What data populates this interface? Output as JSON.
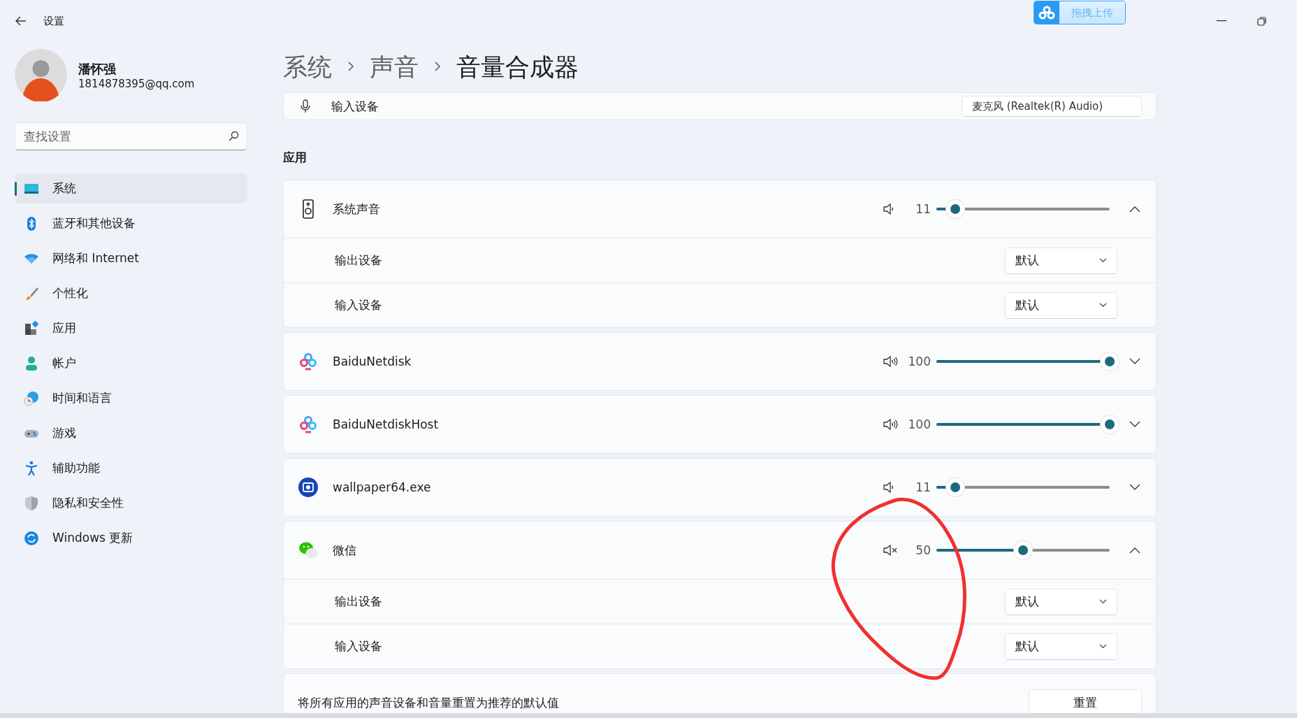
{
  "window": {
    "title": "设置"
  },
  "upload_widget": {
    "label": "拖拽上传"
  },
  "user": {
    "name": "潘怀强",
    "email": "1814878395@qq.com"
  },
  "search": {
    "placeholder": "查找设置"
  },
  "sidebar": {
    "items": [
      {
        "label": "系统",
        "selected": true
      },
      {
        "label": "蓝牙和其他设备",
        "selected": false
      },
      {
        "label": "网络和 Internet",
        "selected": false
      },
      {
        "label": "个性化",
        "selected": false
      },
      {
        "label": "应用",
        "selected": false
      },
      {
        "label": "帐户",
        "selected": false
      },
      {
        "label": "时间和语言",
        "selected": false
      },
      {
        "label": "游戏",
        "selected": false
      },
      {
        "label": "辅助功能",
        "selected": false
      },
      {
        "label": "隐私和安全性",
        "selected": false
      },
      {
        "label": "Windows 更新",
        "selected": false
      }
    ]
  },
  "breadcrumb": [
    "系统",
    "声音",
    "音量合成器"
  ],
  "partial_row": {
    "label": "输入设备",
    "value": "麦克风 (Realtek(R) Audio)"
  },
  "section_title": "应用",
  "apps": [
    {
      "name": "系统声音",
      "reading": "11",
      "level": 0.11,
      "muted": false,
      "expanded": true,
      "devices": [
        {
          "label": "输出设备",
          "value": "默认"
        },
        {
          "label": "输入设备",
          "value": "默认"
        }
      ]
    },
    {
      "name": "BaiduNetdisk",
      "reading": "100",
      "level": 1,
      "muted": false,
      "expanded": false
    },
    {
      "name": "BaiduNetdiskHost",
      "reading": "100",
      "level": 1,
      "muted": false,
      "expanded": false
    },
    {
      "name": "wallpaper64.exe",
      "reading": "11",
      "level": 0.11,
      "muted": false,
      "expanded": false
    },
    {
      "name": "微信",
      "reading": "50",
      "level": 0.5,
      "muted": true,
      "expanded": true,
      "devices": [
        {
          "label": "输出设备",
          "value": "默认"
        },
        {
          "label": "输入设备",
          "value": "默认"
        }
      ]
    }
  ],
  "reset": {
    "text": "将所有应用的声音设备和音量重置为推荐的默认值",
    "button": "重置"
  }
}
